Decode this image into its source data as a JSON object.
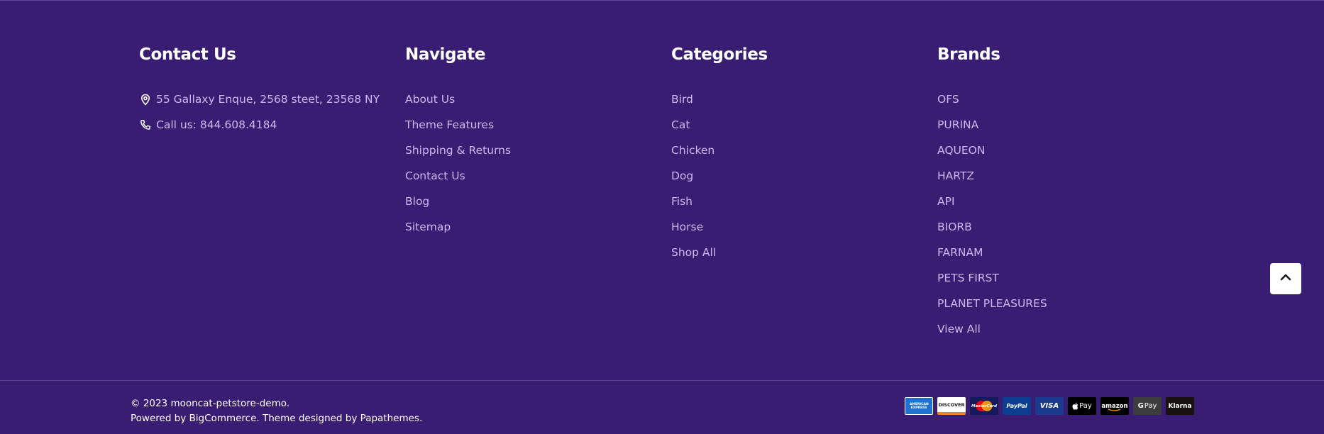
{
  "contact": {
    "title": "Contact Us",
    "address": "55 Gallaxy Enque, 2568 steet, 23568 NY",
    "phone": "Call us: 844.608.4184"
  },
  "navigate": {
    "title": "Navigate",
    "items": [
      "About Us",
      "Theme Features",
      "Shipping & Returns",
      "Contact Us",
      "Blog",
      "Sitemap"
    ]
  },
  "categories": {
    "title": "Categories",
    "items": [
      "Bird",
      "Cat",
      "Chicken",
      "Dog",
      "Fish",
      "Horse",
      "Shop All"
    ]
  },
  "brands": {
    "title": "Brands",
    "items": [
      "OFS",
      "PURINA",
      "AQUEON",
      "HARTZ",
      "API",
      "BIORB",
      "FARNAM",
      "PETS FIRST",
      "PLANET PLEASURES",
      "View All"
    ]
  },
  "bottom": {
    "copyright": "© 2023 mooncat-petstore-demo.",
    "powered_prefix": "Powered by ",
    "bigcommerce": "BigCommerce",
    "theme_text": ". Theme designed by ",
    "papathemes": "Papathemes",
    "suffix": "."
  },
  "payments": {
    "amex": "AMERICAN EXPRESS",
    "discover": "DISCOVER",
    "mastercard": "MasterCard",
    "paypal": "PayPal",
    "visa": "VISA",
    "applepay": "Pay",
    "amazon": "amazon",
    "gpay": "Pay",
    "klarna": "Klarna"
  },
  "colors": {
    "background": "#391d73",
    "link": "#c9b9ef",
    "heading": "#ffffff"
  }
}
